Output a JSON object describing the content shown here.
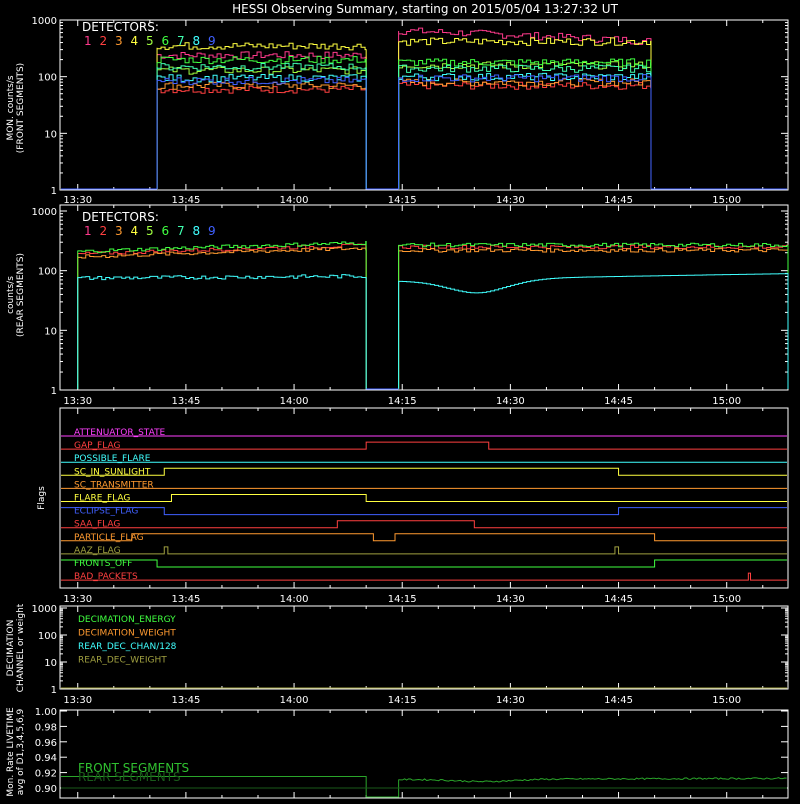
{
  "title": "HESSI Observing Summary, starting on 2015/05/04 13:27:32 UT",
  "colors": {
    "d1": "#ff3a8c",
    "d2": "#ff4040",
    "d3": "#ff9a30",
    "d4": "#ffff40",
    "d5": "#a0ff40",
    "d6": "#40ff40",
    "d7": "#40ffb0",
    "d8": "#40ffff",
    "d9": "#4060ff",
    "axis": "#ffffff",
    "bg": "#000000"
  },
  "x_ticks": [
    "13:30",
    "13:45",
    "14:00",
    "14:15",
    "14:30",
    "14:45",
    "15:00"
  ],
  "x_tick_minutes": [
    0,
    15,
    30,
    45,
    60,
    75,
    90
  ],
  "x_range_minutes": [
    -2.46,
    98.5
  ],
  "panels": {
    "front": {
      "ylabel1": "MON. counts/s",
      "ylabel2": "(FRONT SEGMENTS)",
      "yticks": [
        "1",
        "10",
        "100",
        "1000"
      ],
      "legend_title": "DETECTORS:",
      "legend_digits": [
        "1",
        "2",
        "3",
        "4",
        "5",
        "6",
        "7",
        "8",
        "9"
      ]
    },
    "rear": {
      "ylabel1": "counts/s",
      "ylabel2": "(REAR SEGMENTS)",
      "yticks": [
        "1",
        "10",
        "100",
        "1000"
      ],
      "legend_title": "DETECTORS:",
      "legend_digits": [
        "1",
        "2",
        "3",
        "4",
        "5",
        "6",
        "7",
        "8",
        "9"
      ]
    },
    "flags": {
      "ylabel": "Flags",
      "items": [
        {
          "label": "ATTENUATOR_STATE",
          "color": "#ff40ff"
        },
        {
          "label": "GAP_FLAG",
          "color": "#ff4040"
        },
        {
          "label": "POSSIBLE_FLARE",
          "color": "#40ffff"
        },
        {
          "label": "SC_IN_SUNLIGHT",
          "color": "#ffff40"
        },
        {
          "label": "SC_TRANSMITTER",
          "color": "#ff9a30"
        },
        {
          "label": "FLARE_FLAG",
          "color": "#ffff40"
        },
        {
          "label": "ECLIPSE_FLAG",
          "color": "#4060ff"
        },
        {
          "label": "SAA_FLAG",
          "color": "#ff4040"
        },
        {
          "label": "PARTICLE_FLAG",
          "color": "#ff9a30"
        },
        {
          "label": "AAZ_FLAG",
          "color": "#a0a040"
        },
        {
          "label": "FRONTS_OFF",
          "color": "#40ff40"
        },
        {
          "label": "BAD_PACKETS",
          "color": "#ff4040"
        }
      ]
    },
    "decimation": {
      "ylabel1": "DECIMATION",
      "ylabel2": "CHANNEL or weight",
      "yticks": [
        "1",
        "10",
        "100",
        "1000"
      ],
      "legend": [
        {
          "label": "DECIMATION_ENERGY",
          "color": "#40ff40"
        },
        {
          "label": "DECIMATION_WEIGHT",
          "color": "#ff9a30"
        },
        {
          "label": "REAR_DEC_CHAN/128",
          "color": "#40ffff"
        },
        {
          "label": "REAR_DEC_WEIGHT",
          "color": "#a0a040"
        }
      ]
    },
    "livetime": {
      "ylabel1": "Mon. Rate LIVETIME",
      "ylabel2": "avg of D1,3,4,5,6,9",
      "yticks": [
        "0.90",
        "0.92",
        "0.94",
        "0.96",
        "0.98",
        "1.00"
      ],
      "legend": [
        {
          "label": "FRONT SEGMENTS",
          "color": "#30c030"
        },
        {
          "label": "REAR SEGMENTS",
          "color": "#1a5a1a"
        }
      ]
    }
  },
  "chart_data": [
    {
      "type": "line",
      "title": "HESSI Observing Summary, starting on 2015/05/04 13:27:32 UT",
      "ylabel": "MON. counts/s (FRONT SEGMENTS)",
      "yscale": "log",
      "ylim": [
        1,
        1000
      ],
      "x_unit": "minutes after 13:30 UT",
      "segments": [
        [
          11,
          40
        ],
        [
          44.5,
          79.5
        ]
      ],
      "series": [
        {
          "name": "1",
          "values": [
            240,
            650
          ]
        },
        {
          "name": "2",
          "values": [
            60,
            70
          ]
        },
        {
          "name": "3",
          "values": [
            70,
            80
          ]
        },
        {
          "name": "4",
          "values": [
            350,
            420
          ]
        },
        {
          "name": "5",
          "values": [
            130,
            160
          ]
        },
        {
          "name": "6",
          "values": [
            200,
            180
          ]
        },
        {
          "name": "7",
          "values": [
            150,
            140
          ]
        },
        {
          "name": "8",
          "values": [
            95,
            100
          ]
        },
        {
          "name": "9",
          "values": [
            85,
            95
          ]
        }
      ]
    },
    {
      "type": "line",
      "ylabel": "counts/s (REAR SEGMENTS)",
      "yscale": "log",
      "ylim": [
        1,
        1000
      ],
      "x_unit": "minutes after 13:30 UT",
      "segments": [
        [
          0,
          40
        ],
        [
          44.5,
          98.5
        ]
      ],
      "series": [
        {
          "name": "2",
          "values": [
            190,
            250
          ]
        },
        {
          "name": "3",
          "values": [
            170,
            220
          ]
        },
        {
          "name": "6",
          "values": [
            210,
            270
          ]
        },
        {
          "name": "8",
          "values": [
            75,
            85
          ]
        }
      ]
    },
    {
      "type": "line",
      "ylabel": "avg of D1,3,4,5,6,9 Mon. Rate LIVETIME",
      "ylim": [
        0.9,
        1.0
      ],
      "series": [
        {
          "name": "FRONT SEGMENTS",
          "values": [
            0.915,
            0.911
          ]
        },
        {
          "name": "REAR SEGMENTS",
          "values": [
            0.9,
            0.9
          ]
        }
      ]
    }
  ]
}
